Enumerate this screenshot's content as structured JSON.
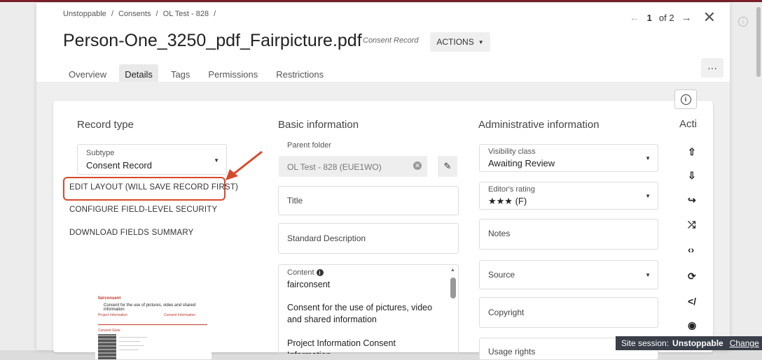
{
  "breadcrumb": [
    "Unstoppable",
    "/",
    "Consents",
    "/",
    "OL Test - 828",
    "/"
  ],
  "pager": {
    "current": "1",
    "of_label": "of 2"
  },
  "header": {
    "title": "Person-One_3250_pdf_Fairpicture.pdf",
    "subtitle": "Consent Record",
    "actions_label": "ACTIONS",
    "more_label": "···"
  },
  "tabs": [
    {
      "label": "Overview",
      "active": false
    },
    {
      "label": "Details",
      "active": true
    },
    {
      "label": "Tags",
      "active": false
    },
    {
      "label": "Permissions",
      "active": false
    },
    {
      "label": "Restrictions",
      "active": false
    }
  ],
  "record_type": {
    "title": "Record type",
    "subtype_label": "Subtype",
    "subtype_value": "Consent Record",
    "links": [
      "EDIT LAYOUT (WILL SAVE RECORD FIRST)",
      "CONFIGURE FIELD-LEVEL SECURITY",
      "DOWNLOAD FIELDS SUMMARY"
    ]
  },
  "basic_info": {
    "title": "Basic information",
    "parent_label": "Parent folder",
    "parent_value": "OL Test - 828 (EUE1WO)",
    "title_label": "Title",
    "description_label": "Standard Description",
    "content_label": "Content",
    "content_lines": [
      "fairconsent",
      "Consent for the use of pictures, video and shared information",
      "Project Information Consent Information"
    ]
  },
  "admin_info": {
    "title": "Administrative information",
    "visibility_label": "Visibility class",
    "visibility_value": "Awaiting Review",
    "rating_label": "Editor's rating",
    "rating_value": "★★★ (F)",
    "notes_label": "Notes",
    "source_label": "Source",
    "copyright_label": "Copyright",
    "usage_label": "Usage rights"
  },
  "actions_column": {
    "title": "Acti"
  },
  "thumbnail": {
    "brand": "fairconsent",
    "heading": "Consent for the use of pictures, video and shared information",
    "project_label": "Project Information",
    "consent_label": "Consent Information",
    "giver_label": "Consent Giver"
  },
  "site_session": {
    "label": "Site session:",
    "value": "Unstoppable",
    "change": "Change"
  }
}
